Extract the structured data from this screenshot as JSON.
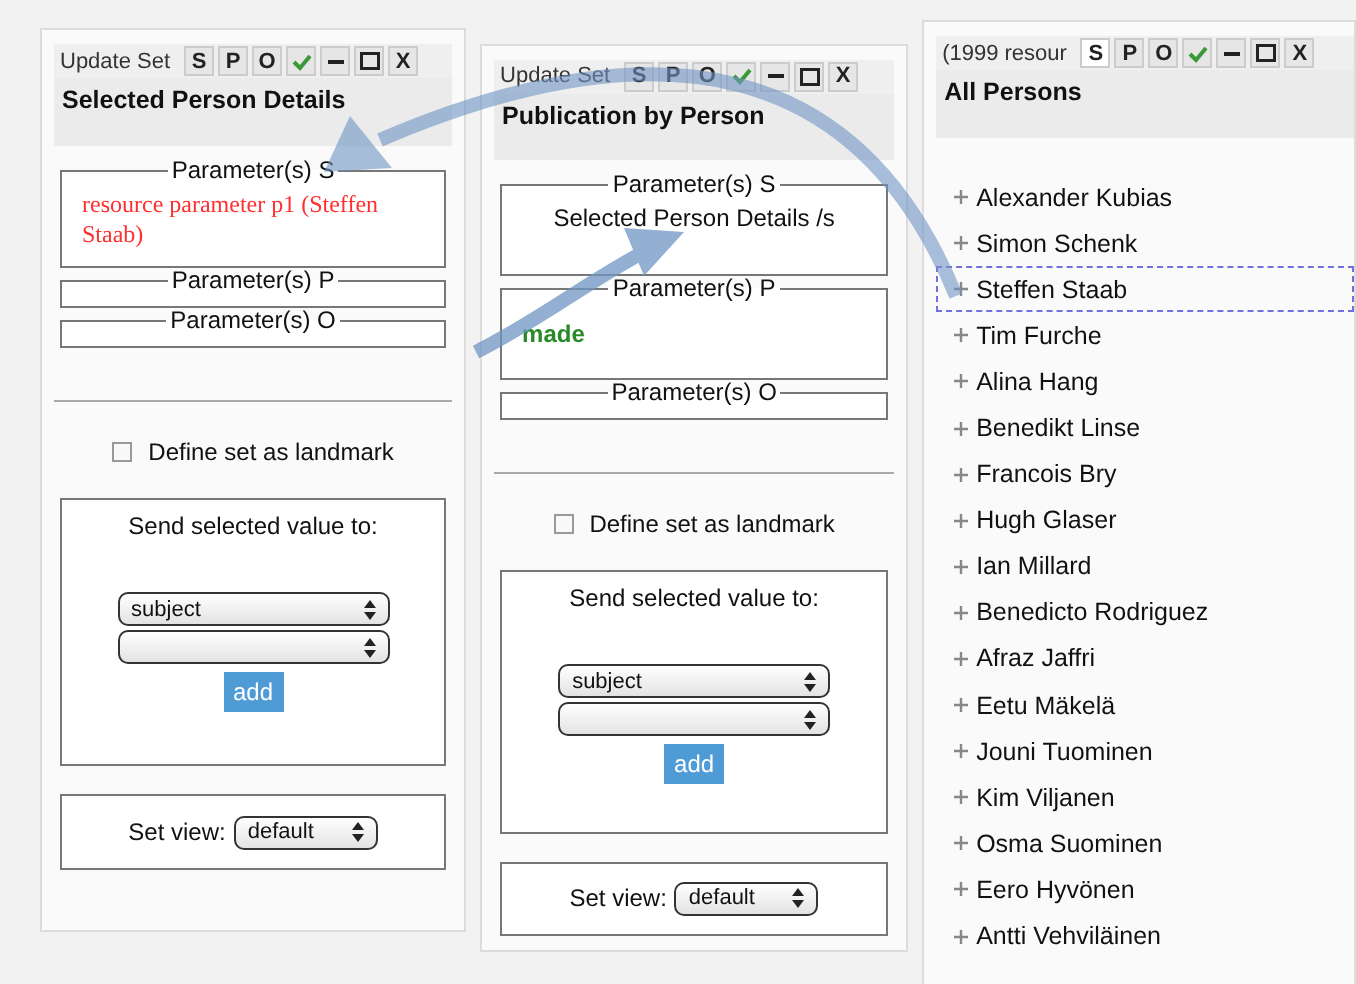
{
  "panels": [
    {
      "kind": "set",
      "header": "Update Set",
      "tool_buttons": [
        {
          "label": "S",
          "selected": false
        },
        {
          "label": "P",
          "selected": false
        },
        {
          "label": "O",
          "selected": false
        },
        {
          "label": "X",
          "selected": false
        }
      ],
      "title": "Selected Person Details",
      "parameters": [
        {
          "legend": "Parameter(s) S",
          "kind": "resource",
          "value": "resource parameter p1 (Steffen Staab)"
        },
        {
          "legend": "Parameter(s) P"
        },
        {
          "legend": "Parameter(s) O"
        }
      ],
      "landmark": {
        "label": "Define set as landmark",
        "checked": false
      },
      "send": {
        "label": "Send selected value to:",
        "selects": [
          {
            "kind": "filled",
            "value": "subject"
          },
          {
            "kind": "blank"
          }
        ],
        "button": "add"
      },
      "view": {
        "label": "Set view:",
        "value": "default"
      }
    },
    {
      "kind": "set",
      "header": "Update Set",
      "tool_buttons": [
        {
          "label": "S",
          "selected": false
        },
        {
          "label": "P",
          "selected": false
        },
        {
          "label": "O",
          "selected": false
        },
        {
          "label": "X",
          "selected": false
        }
      ],
      "title": "Publication by Person",
      "parameters": [
        {
          "legend": "Parameter(s) S",
          "kind": "set",
          "value": "Selected Person Details /s"
        },
        {
          "legend": "Parameter(s) P",
          "kind": "property",
          "value": "made"
        },
        {
          "legend": "Parameter(s) O"
        }
      ],
      "landmark": {
        "label": "Define set as landmark",
        "checked": false
      },
      "send": {
        "label": "Send selected value to:",
        "selects": [
          {
            "kind": "filled",
            "value": "subject"
          },
          {
            "kind": "blank"
          }
        ],
        "button": "add"
      },
      "view": {
        "label": "Set view:",
        "value": "default"
      }
    },
    {
      "kind": "list",
      "header": "(1999 resour",
      "tool_buttons": [
        {
          "label": "S",
          "selected": true
        },
        {
          "label": "P",
          "selected": false
        },
        {
          "label": "O",
          "selected": false
        },
        {
          "label": "X",
          "selected": false
        }
      ],
      "title": "All Persons",
      "items": [
        {
          "label": "Alexander Kubias",
          "selected": false
        },
        {
          "label": "Simon Schenk",
          "selected": false
        },
        {
          "label": "Steffen Staab",
          "selected": true
        },
        {
          "label": "Tim Furche",
          "selected": false
        },
        {
          "label": "Alina Hang",
          "selected": false
        },
        {
          "label": "Benedikt Linse",
          "selected": false
        },
        {
          "label": "Francois Bry",
          "selected": false
        },
        {
          "label": "Hugh Glaser",
          "selected": false
        },
        {
          "label": "Ian Millard",
          "selected": false
        },
        {
          "label": "Benedicto Rodriguez",
          "selected": false
        },
        {
          "label": "Afraz Jaffri",
          "selected": false
        },
        {
          "label": "Eetu Mäkelä",
          "selected": false
        },
        {
          "label": "Jouni Tuominen",
          "selected": false
        },
        {
          "label": "Kim Viljanen",
          "selected": false
        },
        {
          "label": "Osma Suominen",
          "selected": false
        },
        {
          "label": "Eero Hyvönen",
          "selected": false
        },
        {
          "label": "Antti Vehviläinen",
          "selected": false
        }
      ]
    }
  ]
}
